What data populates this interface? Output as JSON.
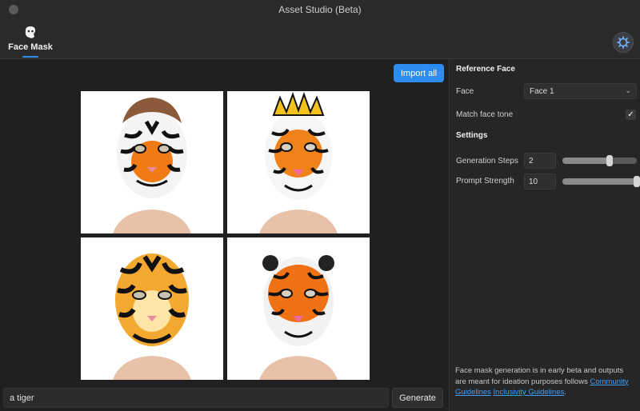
{
  "window": {
    "title": "Asset Studio (Beta)"
  },
  "toolbar": {
    "tab_label": "Face Mask",
    "settings_icon": "gear-icon",
    "tab_icon": "face-mask-icon"
  },
  "main": {
    "import_all_label": "Import all",
    "prompt_value": "a tiger",
    "generate_label": "Generate",
    "results": [
      {
        "name": "tiger-mask-result-1"
      },
      {
        "name": "tiger-mask-result-2"
      },
      {
        "name": "tiger-mask-result-3"
      },
      {
        "name": "tiger-mask-result-4"
      }
    ]
  },
  "sidebar": {
    "reference_title": "Reference Face",
    "face_label": "Face",
    "face_value": "Face 1",
    "match_tone_label": "Match face tone",
    "match_tone_checked": true,
    "settings_title": "Settings",
    "steps_label": "Generation Steps",
    "steps_value": "2",
    "steps_fraction": 0.63,
    "strength_label": "Prompt Strength",
    "strength_value": "10",
    "strength_fraction": 1.0,
    "note_text_1": "Face mask generation is in early beta and outputs are meant for ideation purposes",
    "note_text_2": "follows",
    "note_link_1": "Community Guidelines",
    "note_link_2": "Inclusivity Guidelines",
    "note_text_3": "."
  },
  "colors": {
    "accent": "#2d8cf0",
    "background": "#232323",
    "panel": "#262626"
  }
}
